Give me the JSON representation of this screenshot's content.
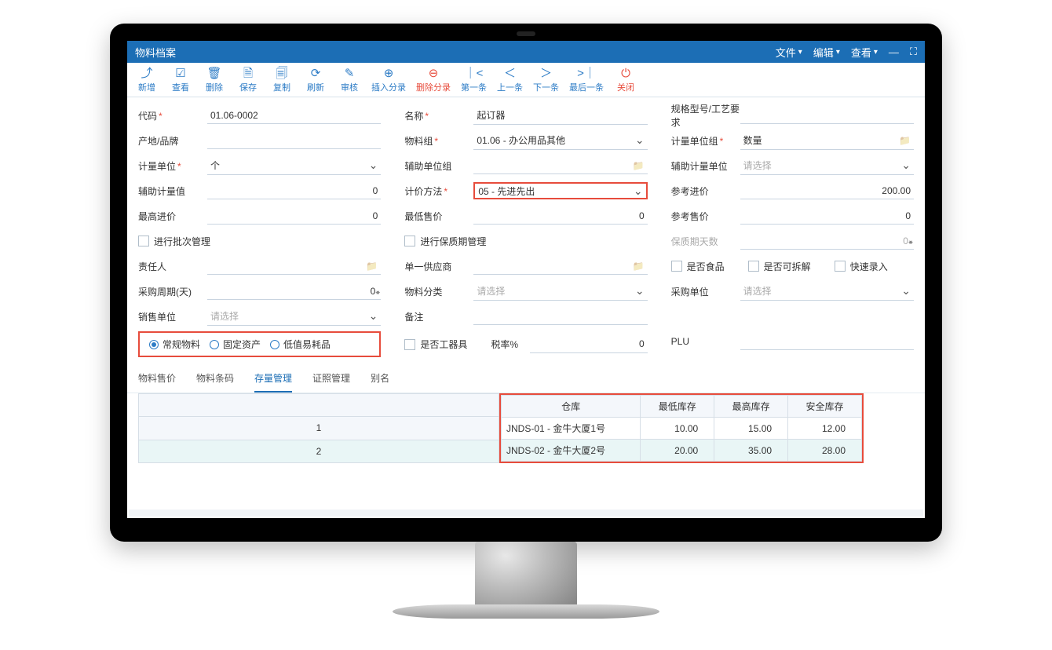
{
  "title": "物料档案",
  "menus": {
    "file": "文件",
    "edit": "编辑",
    "view": "查看"
  },
  "toolbar": [
    {
      "icon": "⤴",
      "label": "新增"
    },
    {
      "icon": "☑",
      "label": "查看"
    },
    {
      "icon": "🗑",
      "label": "删除"
    },
    {
      "icon": "🗎",
      "label": "保存"
    },
    {
      "icon": "🗐",
      "label": "复制"
    },
    {
      "icon": "⟳",
      "label": "刷新"
    },
    {
      "icon": "✎",
      "label": "审核"
    },
    {
      "icon": "⊕",
      "label": "插入分录",
      "cls": ""
    },
    {
      "icon": "⊖",
      "label": "删除分录",
      "cls": "red"
    },
    {
      "icon": "｜<",
      "label": "第一条"
    },
    {
      "icon": "＜",
      "label": "上一条"
    },
    {
      "icon": "＞",
      "label": "下一条"
    },
    {
      "icon": ">｜",
      "label": "最后一条"
    },
    {
      "icon": "⏻",
      "label": "关闭",
      "cls": "red"
    }
  ],
  "form": {
    "code_lbl": "代码",
    "code": "01.06-0002",
    "name_lbl": "名称",
    "name": "起订器",
    "spec_lbl": "规格型号/工艺要求",
    "origin_lbl": "产地/品牌",
    "matgroup_lbl": "物料组",
    "matgroup": "01.06 - 办公用品其他",
    "uomgroup_lbl": "计量单位组",
    "uomgroup": "数量",
    "uom_lbl": "计量单位",
    "uom": "个",
    "auxuomgroup_lbl": "辅助单位组",
    "auxuom_lbl": "辅助计量单位",
    "please_select": "请选择",
    "auxval_lbl": "辅助计量值",
    "auxval": "0",
    "pricemethod_lbl": "计价方法",
    "pricemethod": "05 - 先进先出",
    "refin_lbl": "参考进价",
    "refin": "200.00",
    "maxin_lbl": "最高进价",
    "maxin": "0",
    "minsale_lbl": "最低售价",
    "minsale": "0",
    "refsale_lbl": "参考售价",
    "refsale": "0",
    "batch_lbl": "进行批次管理",
    "shelf_lbl": "进行保质期管理",
    "shelfdays_lbl": "保质期天数",
    "shelfdays": "0",
    "owner_lbl": "责任人",
    "singlesupp_lbl": "单一供应商",
    "isfood_lbl": "是否食品",
    "issplit_lbl": "是否可拆解",
    "quickin_lbl": "快速录入",
    "leadtime_lbl": "采购周期(天)",
    "leadtime": "0",
    "matcat_lbl": "物料分类",
    "purchuom_lbl": "采购单位",
    "saleuom_lbl": "销售单位",
    "remark_lbl": "备注",
    "istool_lbl": "是否工器具",
    "taxrate_lbl": "税率%",
    "taxrate": "0",
    "plu_lbl": "PLU",
    "radio_normal": "常规物料",
    "radio_fixed": "固定资产",
    "radio_low": "低值易耗品"
  },
  "tabs": [
    "物料售价",
    "物料条码",
    "存量管理",
    "证照管理",
    "别名"
  ],
  "active_tab": 2,
  "grid": {
    "headers": [
      "仓库",
      "最低库存",
      "最高库存",
      "安全库存"
    ],
    "rows": [
      {
        "n": "1",
        "wh": "JNDS-01 - 金牛大厦1号",
        "min": "10.00",
        "max": "15.00",
        "safe": "12.00"
      },
      {
        "n": "2",
        "wh": "JNDS-02 - 金牛大厦2号",
        "min": "20.00",
        "max": "35.00",
        "safe": "28.00"
      }
    ]
  }
}
